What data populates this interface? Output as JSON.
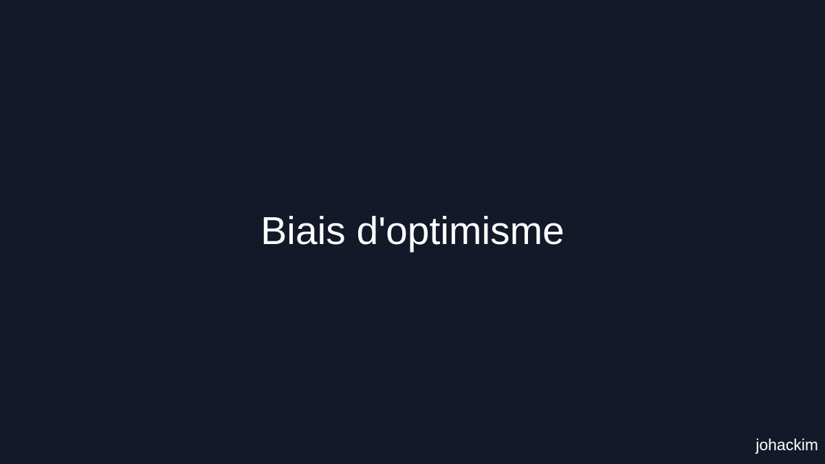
{
  "slide": {
    "title": "Biais d'optimisme",
    "author": "johackim"
  },
  "colors": {
    "background": "#131929",
    "text": "#ffffff"
  }
}
